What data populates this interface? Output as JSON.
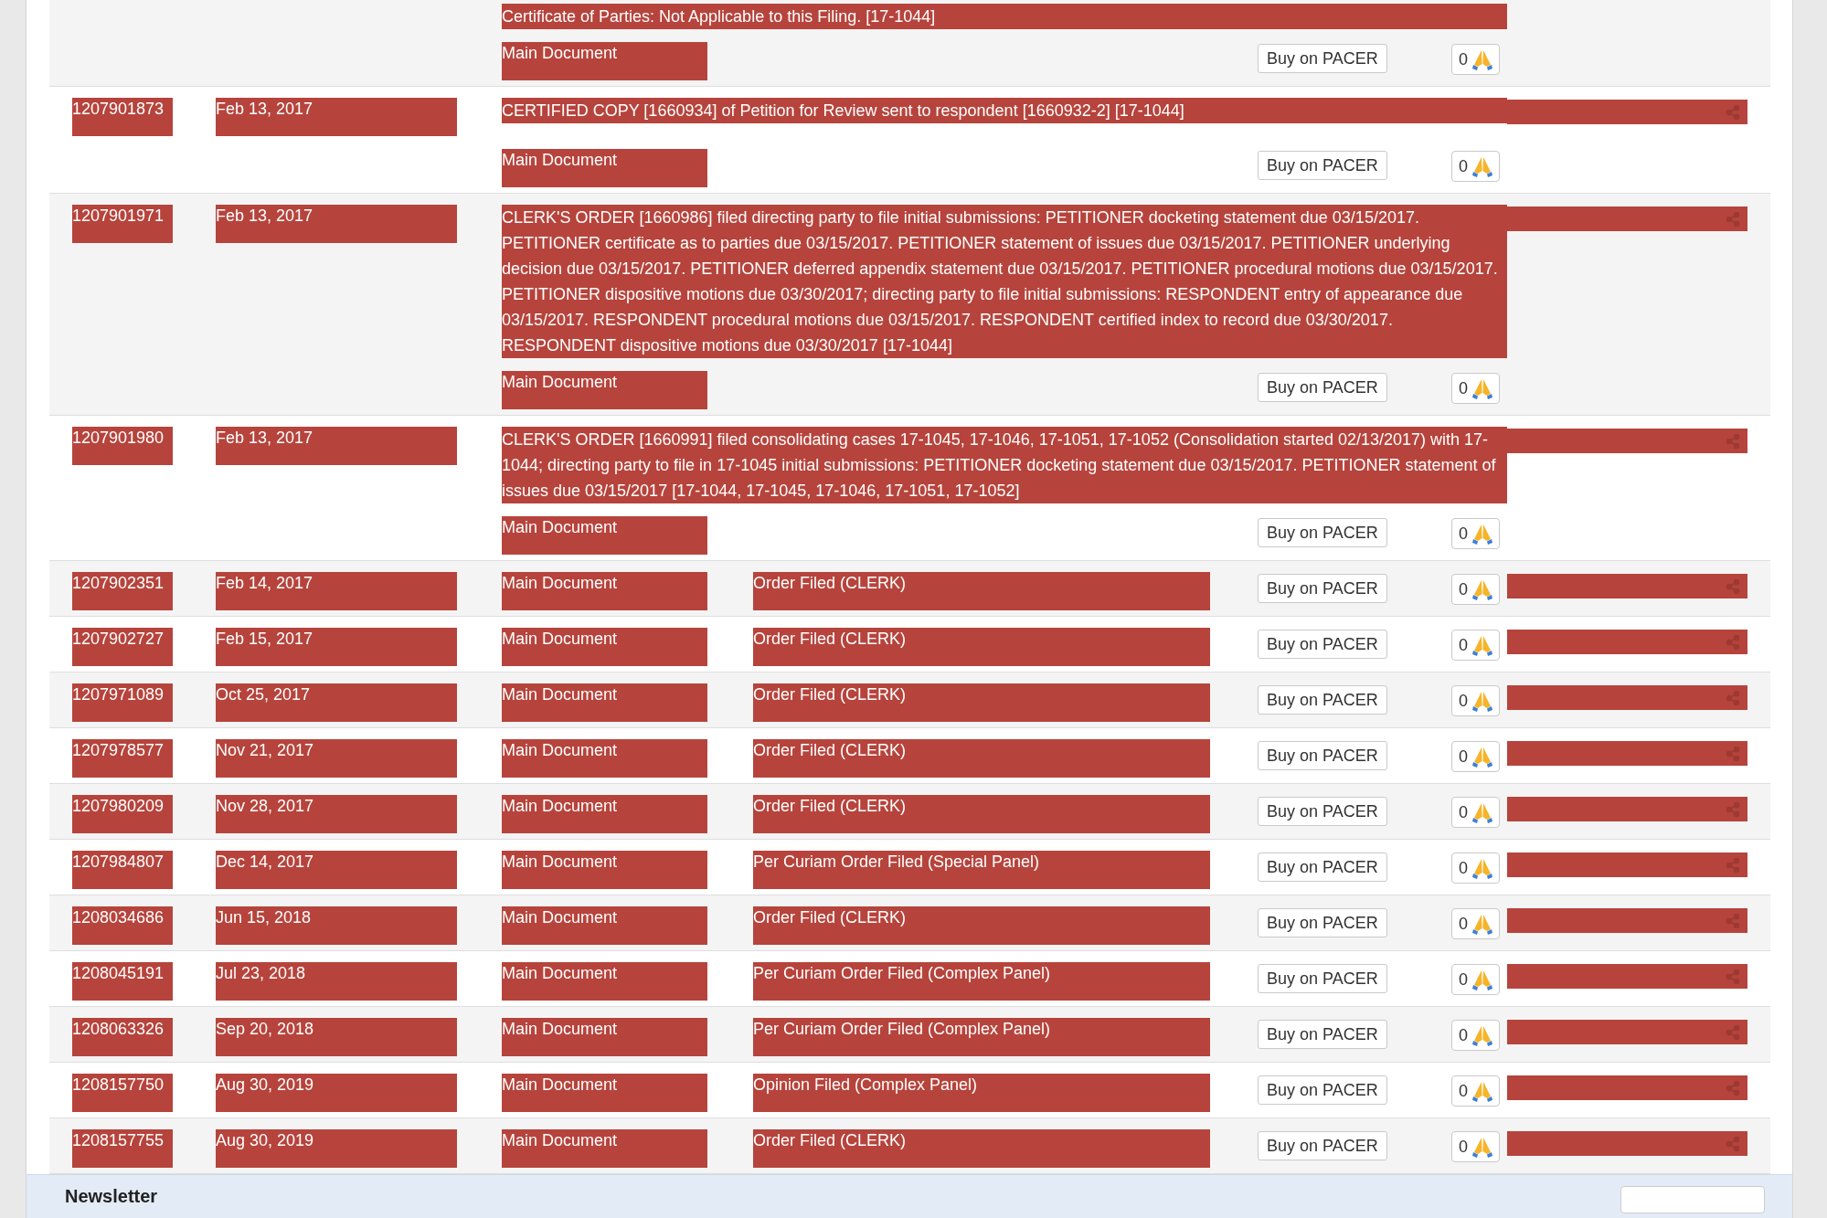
{
  "docket": [
    {
      "kind": "continued",
      "description": "Certificate of Parties: Not Applicable to this Filing. [17-1044]",
      "document": "Main Document",
      "buy": "Buy on PACER",
      "count": "0"
    },
    {
      "kind": "long",
      "number": "1207901873",
      "date": "Feb 13, 2017",
      "description": "CERTIFIED COPY [1660934] of Petition for Review sent to respondent [1660932-2] [17-1044]",
      "document": "Main Document",
      "buy": "Buy on PACER",
      "count": "0"
    },
    {
      "kind": "long",
      "number": "1207901971",
      "date": "Feb 13, 2017",
      "description": "CLERK'S ORDER [1660986] filed directing party to file initial submissions: PETITIONER docketing statement due 03/15/2017. PETITIONER certificate as to parties due 03/15/2017. PETITIONER statement of issues due 03/15/2017. PETITIONER underlying decision due 03/15/2017. PETITIONER deferred appendix statement due 03/15/2017. PETITIONER procedural motions due 03/15/2017. PETITIONER dispositive motions due 03/30/2017; directing party to file initial submissions: RESPONDENT entry of appearance due 03/15/2017. RESPONDENT procedural motions due 03/15/2017. RESPONDENT certified index to record due 03/30/2017. RESPONDENT dispositive motions due 03/30/2017 [17-1044]",
      "document": "Main Document",
      "buy": "Buy on PACER",
      "count": "0"
    },
    {
      "kind": "long",
      "number": "1207901980",
      "date": "Feb 13, 2017",
      "description": "CLERK'S ORDER [1660991] filed consolidating cases 17-1045, 17-1046, 17-1051, 17-1052 (Consolidation started 02/13/2017) with 17-1044; directing party to file in 17-1045 initial submissions: PETITIONER docketing statement due 03/15/2017. PETITIONER statement of issues due 03/15/2017 [17-1044, 17-1045, 17-1046, 17-1051, 17-1052]",
      "document": "Main Document",
      "buy": "Buy on PACER",
      "count": "0"
    },
    {
      "kind": "short",
      "number": "1207902351",
      "date": "Feb 14, 2017",
      "document": "Main Document",
      "description": "Order Filed (CLERK)",
      "buy": "Buy on PACER",
      "count": "0"
    },
    {
      "kind": "short",
      "number": "1207902727",
      "date": "Feb 15, 2017",
      "document": "Main Document",
      "description": "Order Filed (CLERK)",
      "buy": "Buy on PACER",
      "count": "0"
    },
    {
      "kind": "short",
      "number": "1207971089",
      "date": "Oct 25, 2017",
      "document": "Main Document",
      "description": "Order Filed (CLERK)",
      "buy": "Buy on PACER",
      "count": "0"
    },
    {
      "kind": "short",
      "number": "1207978577",
      "date": "Nov 21, 2017",
      "document": "Main Document",
      "description": "Order Filed (CLERK)",
      "buy": "Buy on PACER",
      "count": "0"
    },
    {
      "kind": "short",
      "number": "1207980209",
      "date": "Nov 28, 2017",
      "document": "Main Document",
      "description": "Order Filed (CLERK)",
      "buy": "Buy on PACER",
      "count": "0"
    },
    {
      "kind": "short",
      "number": "1207984807",
      "date": "Dec 14, 2017",
      "document": "Main Document",
      "description": "Per Curiam Order Filed (Special Panel)",
      "buy": "Buy on PACER",
      "count": "0"
    },
    {
      "kind": "short",
      "number": "1208034686",
      "date": "Jun 15, 2018",
      "document": "Main Document",
      "description": "Order Filed (CLERK)",
      "buy": "Buy on PACER",
      "count": "0"
    },
    {
      "kind": "short",
      "number": "1208045191",
      "date": "Jul 23, 2018",
      "document": "Main Document",
      "description": "Per Curiam Order Filed (Complex Panel)",
      "buy": "Buy on PACER",
      "count": "0"
    },
    {
      "kind": "short",
      "number": "1208063326",
      "date": "Sep 20, 2018",
      "document": "Main Document",
      "description": "Per Curiam Order Filed (Complex Panel)",
      "buy": "Buy on PACER",
      "count": "0"
    },
    {
      "kind": "short",
      "number": "1208157750",
      "date": "Aug 30, 2019",
      "document": "Main Document",
      "description": "Opinion Filed (Complex Panel)",
      "buy": "Buy on PACER",
      "count": "0"
    },
    {
      "kind": "short",
      "number": "1208157755",
      "date": "Aug 30, 2019",
      "document": "Main Document",
      "description": "Order Filed (CLERK)",
      "buy": "Buy on PACER",
      "count": "0"
    }
  ],
  "newsletter": {
    "title": "Newsletter"
  }
}
